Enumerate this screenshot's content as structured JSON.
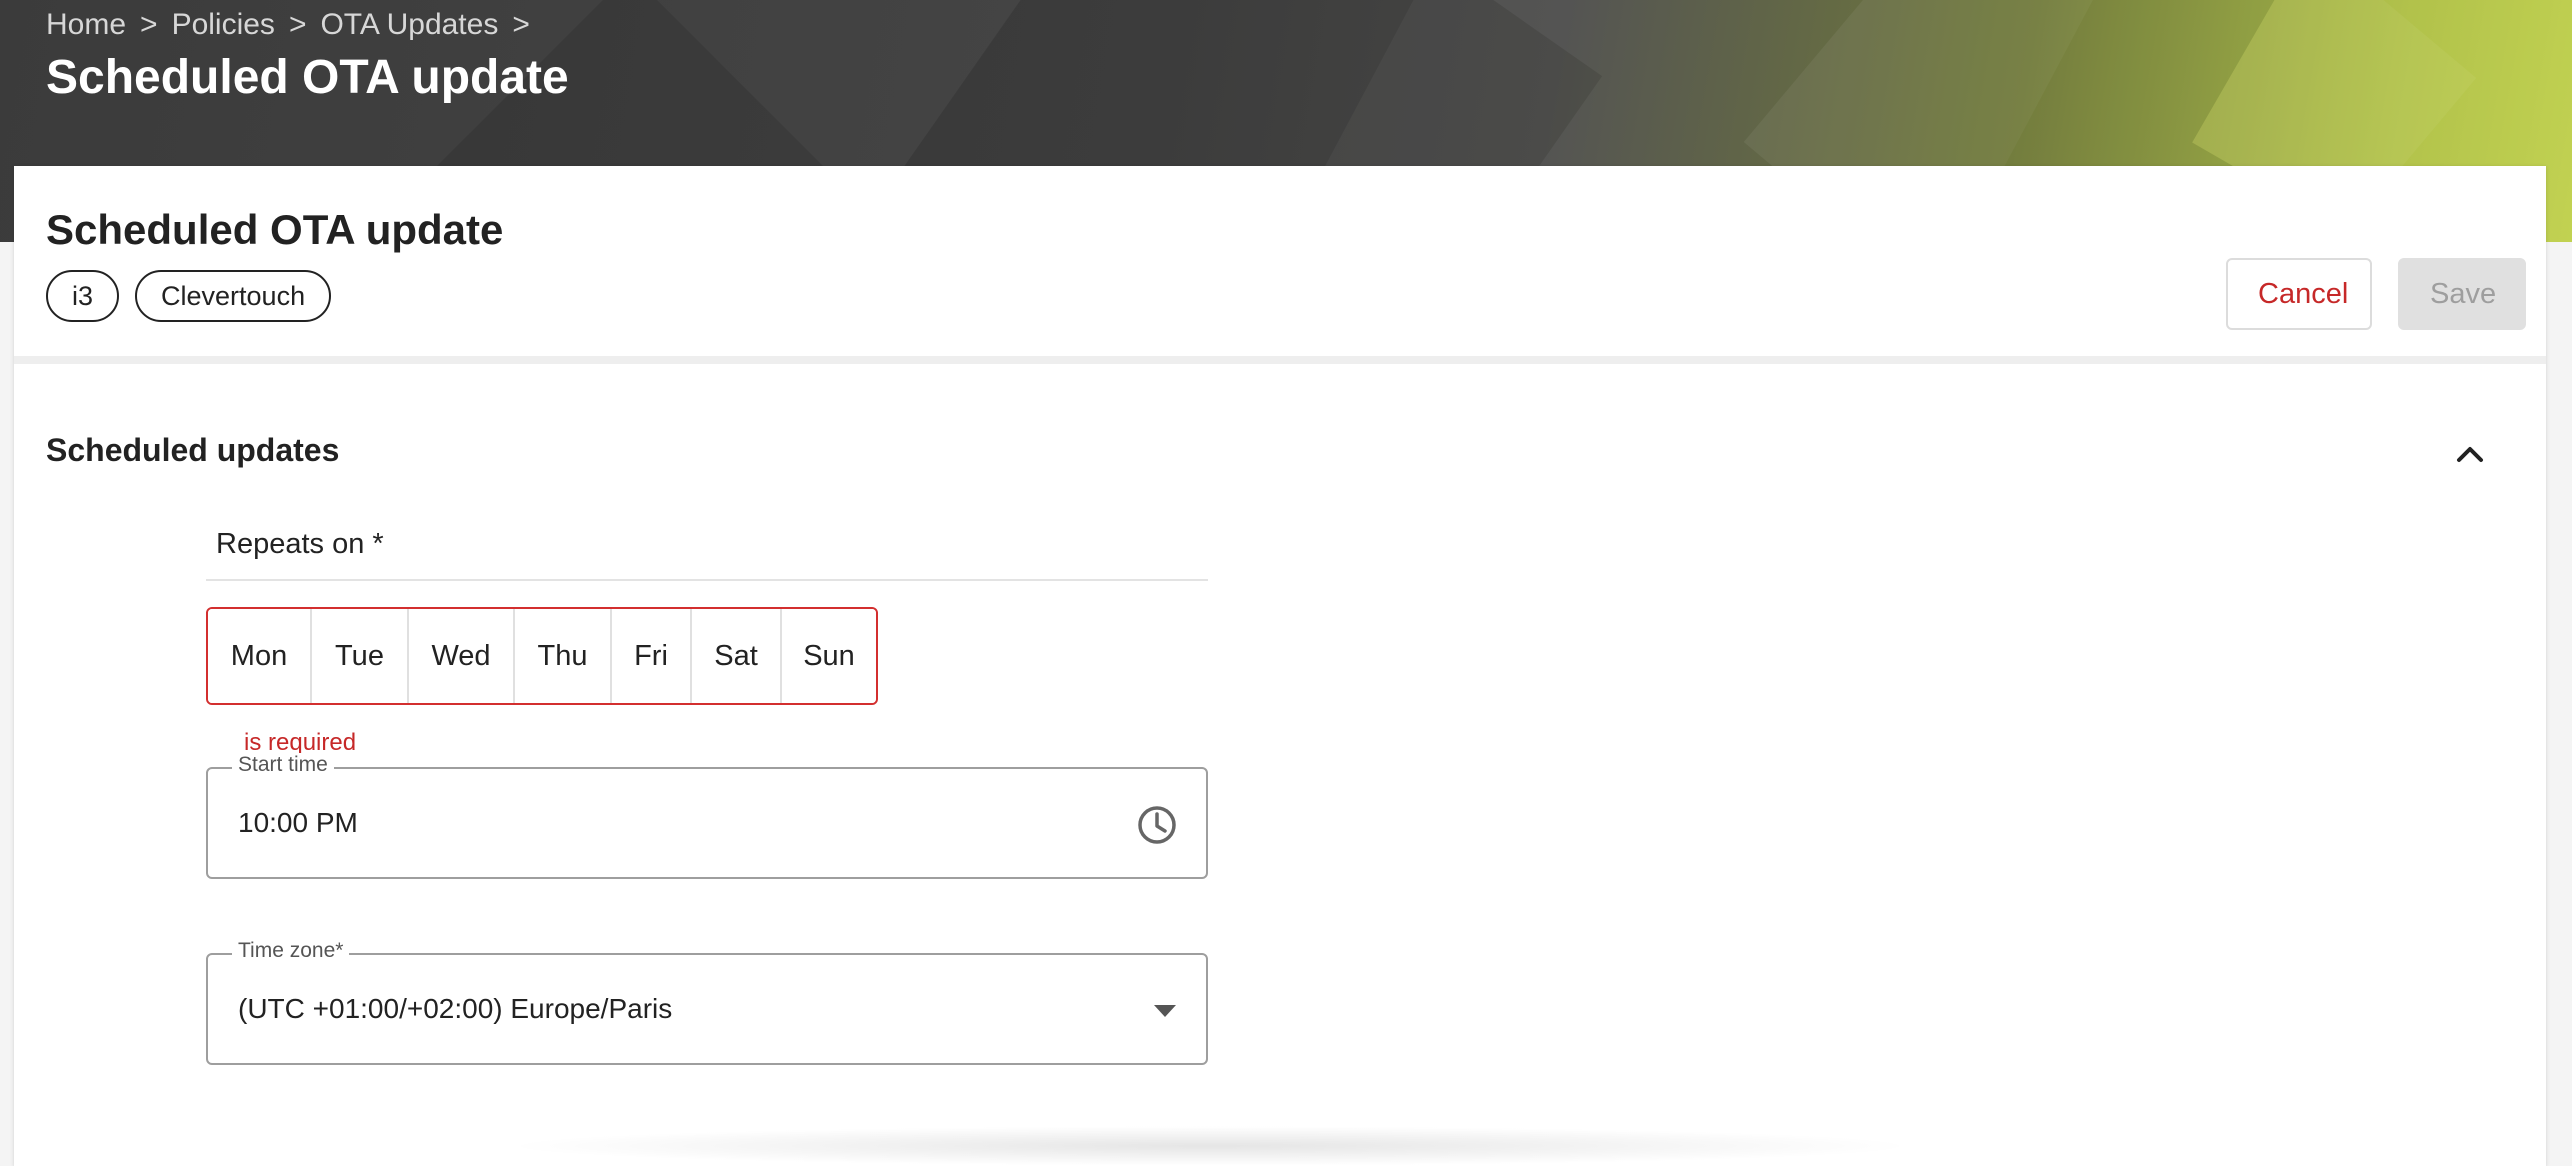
{
  "breadcrumb": {
    "items": [
      "Home",
      "Policies",
      "OTA Updates"
    ],
    "separator": ">"
  },
  "hero": {
    "title": "Scheduled OTA update"
  },
  "card": {
    "title": "Scheduled OTA update",
    "chips": [
      "i3",
      "Clevertouch"
    ],
    "actions": {
      "cancel_label": "Cancel",
      "save_label": "Save"
    }
  },
  "section": {
    "title": "Scheduled updates",
    "collapse_icon": "chevron-up-icon"
  },
  "repeats": {
    "label": "Repeats on *",
    "days": [
      "Mon",
      "Tue",
      "Wed",
      "Thu",
      "Fri",
      "Sat",
      "Sun"
    ],
    "error": "is required"
  },
  "start_time": {
    "label": "Start time",
    "value": "10:00 PM",
    "icon": "clock-icon"
  },
  "time_zone": {
    "label": "Time zone*",
    "value": "(UTC +01:00/+02:00) Europe/Paris",
    "icon": "dropdown-arrow-icon"
  },
  "colors": {
    "error": "#c62828",
    "brand_green": "#b5c845",
    "hero_dark": "#3b3b3b",
    "save_disabled_bg": "#e0e0e0"
  }
}
